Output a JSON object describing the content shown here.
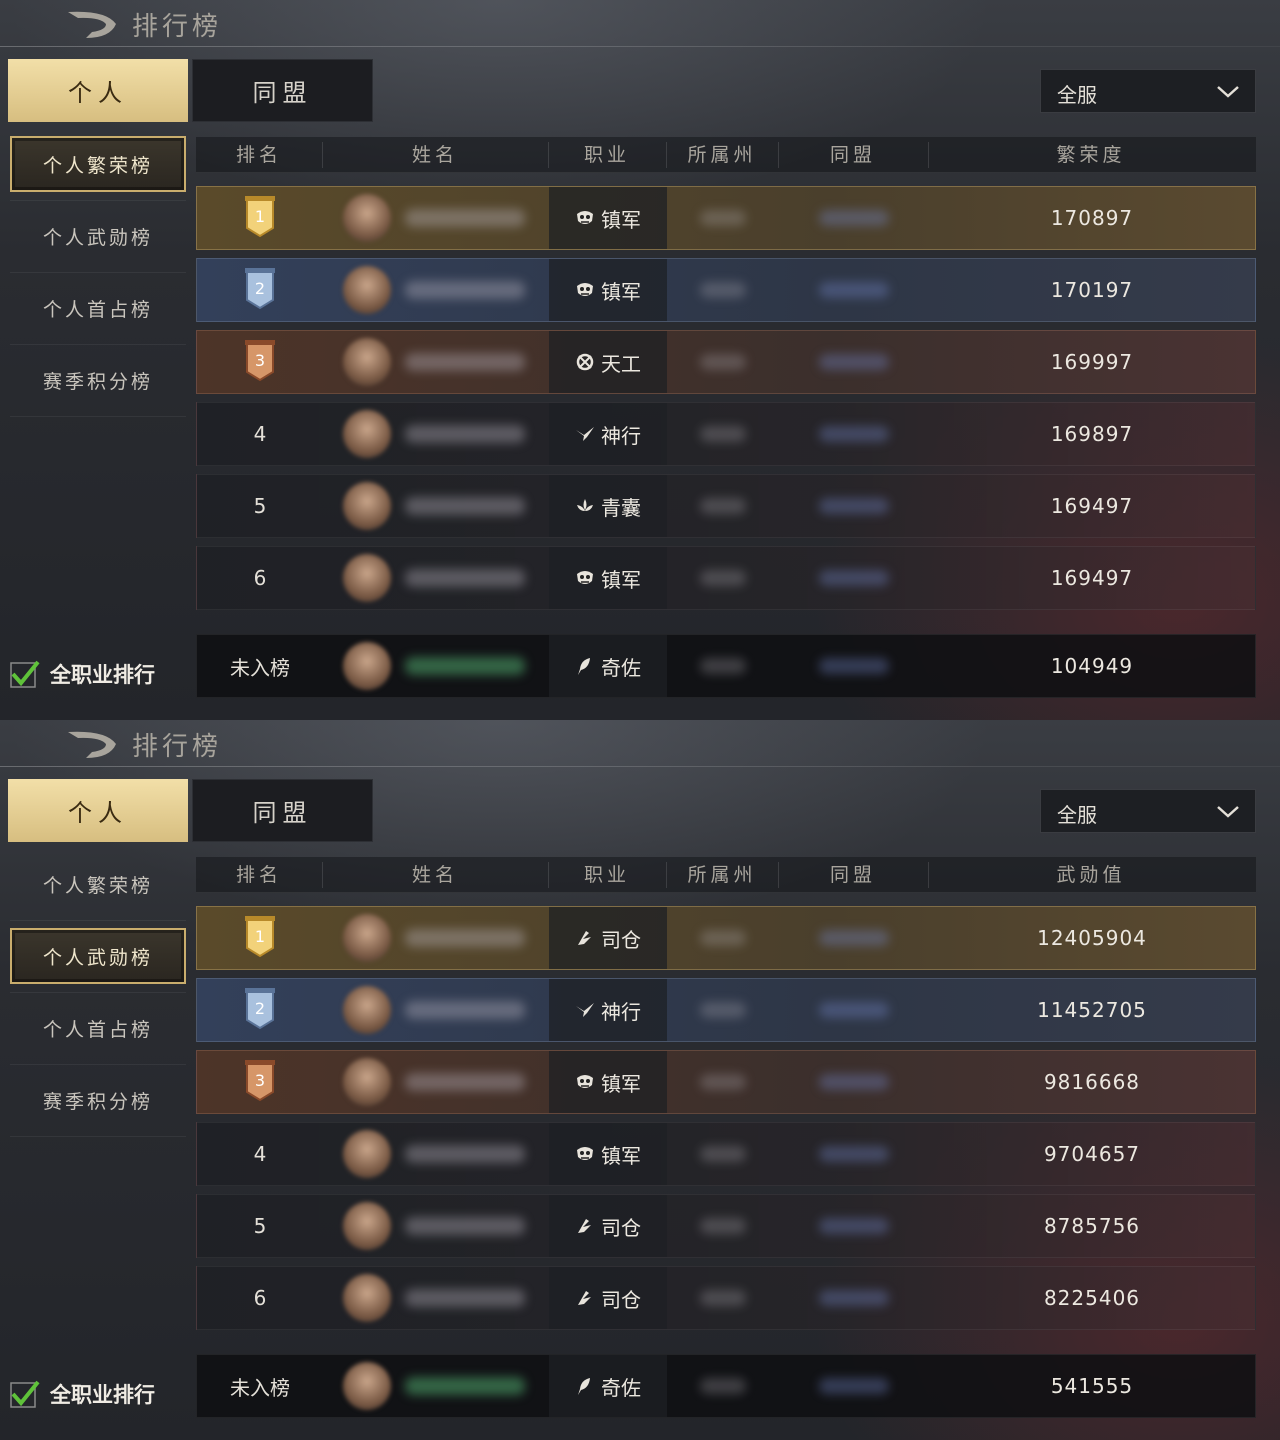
{
  "panels": [
    {
      "title": "排行榜",
      "tabs": {
        "personal": "个人",
        "alliance": "同盟"
      },
      "server_select": "全服",
      "sidebar": [
        "个人繁荣榜",
        "个人武勋榜",
        "个人首占榜",
        "赛季积分榜"
      ],
      "active_sidebar": 0,
      "checkbox_label": "全职业排行",
      "headers": {
        "rank": "排名",
        "name": "姓名",
        "job": "职业",
        "state": "所属州",
        "alliance": "同盟",
        "value": "繁荣度"
      },
      "rows": [
        {
          "rank": "1",
          "job": "镇军",
          "job_icon": "mask-icon",
          "value": "170897"
        },
        {
          "rank": "2",
          "job": "镇军",
          "job_icon": "mask-icon",
          "value": "170197"
        },
        {
          "rank": "3",
          "job": "天工",
          "job_icon": "gear-icon",
          "value": "169997"
        },
        {
          "rank": "4",
          "job": "神行",
          "job_icon": "bird-icon",
          "value": "169897"
        },
        {
          "rank": "5",
          "job": "青囊",
          "job_icon": "lotus-icon",
          "value": "169497"
        },
        {
          "rank": "6",
          "job": "镇军",
          "job_icon": "mask-icon",
          "value": "169497"
        }
      ],
      "self_row": {
        "rank": "未入榜",
        "job": "奇佐",
        "job_icon": "feather-icon",
        "value": "104949"
      }
    },
    {
      "title": "排行榜",
      "tabs": {
        "personal": "个人",
        "alliance": "同盟"
      },
      "server_select": "全服",
      "sidebar": [
        "个人繁荣榜",
        "个人武勋榜",
        "个人首占榜",
        "赛季积分榜"
      ],
      "active_sidebar": 1,
      "checkbox_label": "全职业排行",
      "headers": {
        "rank": "排名",
        "name": "姓名",
        "job": "职业",
        "state": "所属州",
        "alliance": "同盟",
        "value": "武勋值"
      },
      "rows": [
        {
          "rank": "1",
          "job": "司仓",
          "job_icon": "blade-icon",
          "value": "12405904"
        },
        {
          "rank": "2",
          "job": "神行",
          "job_icon": "bird-icon",
          "value": "11452705"
        },
        {
          "rank": "3",
          "job": "镇军",
          "job_icon": "mask-icon",
          "value": "9816668"
        },
        {
          "rank": "4",
          "job": "镇军",
          "job_icon": "mask-icon",
          "value": "9704657"
        },
        {
          "rank": "5",
          "job": "司仓",
          "job_icon": "blade-icon",
          "value": "8785756"
        },
        {
          "rank": "6",
          "job": "司仓",
          "job_icon": "blade-icon",
          "value": "8225406"
        }
      ],
      "self_row": {
        "rank": "未入榜",
        "job": "奇佐",
        "job_icon": "feather-icon",
        "value": "541555"
      }
    }
  ],
  "colors": {
    "accent_gold": "#d7be80",
    "check_green": "#5fc23a"
  }
}
